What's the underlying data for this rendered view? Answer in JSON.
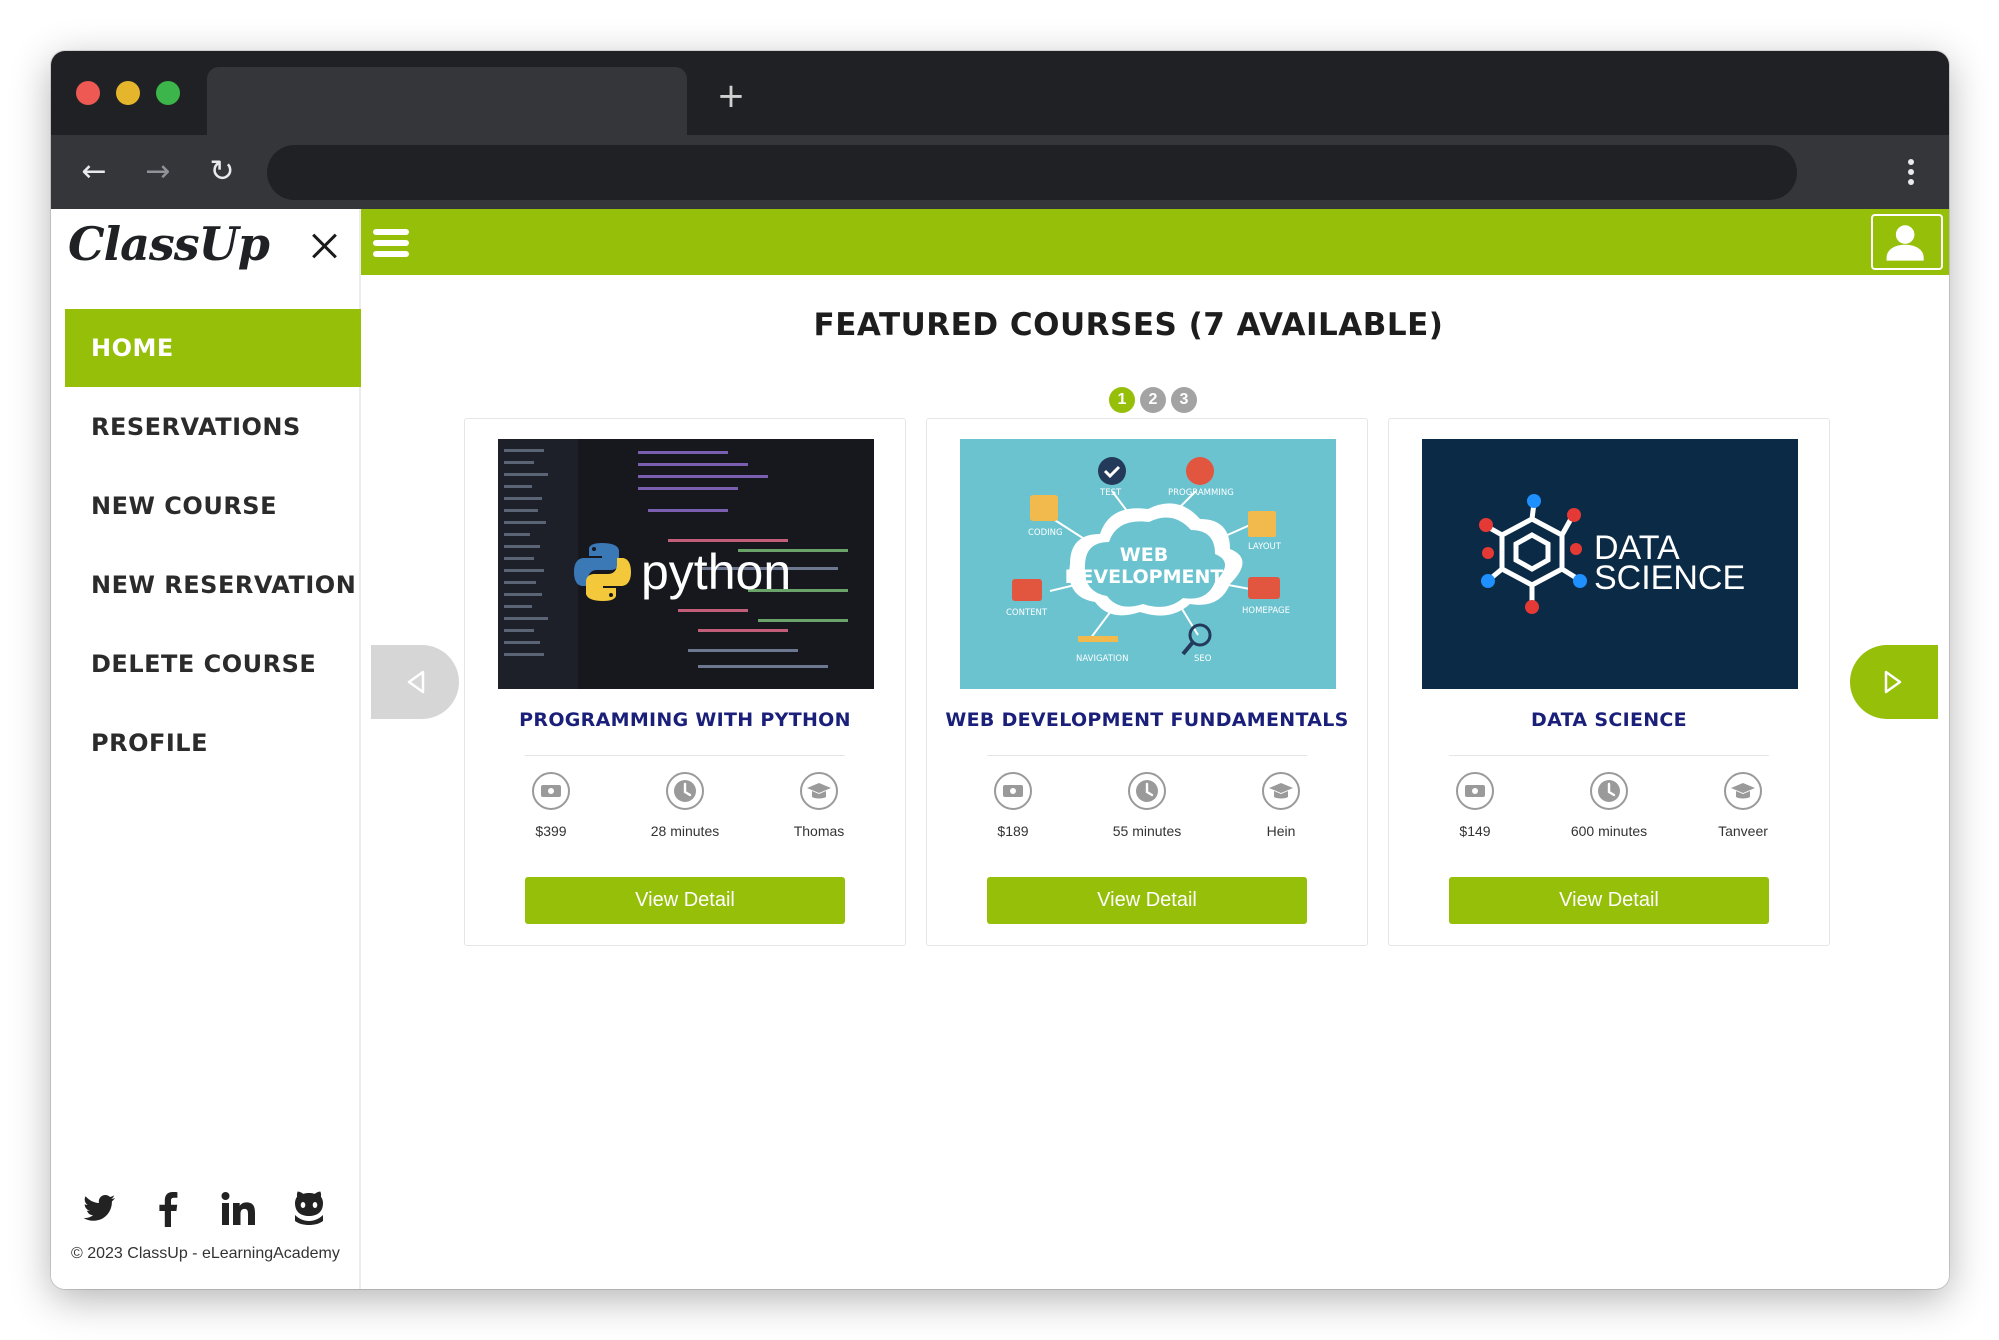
{
  "brand": {
    "logo_text": "ClassUp",
    "accent_color": "#95bf09"
  },
  "sidebar": {
    "items": [
      {
        "label": "HOME"
      },
      {
        "label": "RESERVATIONS"
      },
      {
        "label": "NEW COURSE"
      },
      {
        "label": "NEW RESERVATION"
      },
      {
        "label": "DELETE COURSE"
      },
      {
        "label": "PROFILE"
      }
    ],
    "social_icons": [
      "twitter-icon",
      "facebook-icon",
      "linkedin-icon",
      "github-icon"
    ],
    "copyright": "© 2023 ClassUp - eLearningAcademy"
  },
  "main": {
    "title": "FEATURED COURSES (7 AVAILABLE)",
    "pages": [
      "1",
      "2",
      "3"
    ],
    "current_page": "1",
    "courses": [
      {
        "title": "PROGRAMMING WITH PYTHON",
        "image_text": "python",
        "price": "$399",
        "duration": "28 minutes",
        "instructor": "Thomas",
        "button": "View Detail"
      },
      {
        "title": "WEB DEVELOPMENT FUNDAMENTALS",
        "image_text_line1": "WEB",
        "image_text_line2": "DEVELOPMENT",
        "image_labels": [
          "TEST",
          "PROGRAMMING",
          "CODING",
          "LAYOUT",
          "CONTENT",
          "HOMEPAGE",
          "NAVIGATION",
          "SEO"
        ],
        "price": "$189",
        "duration": "55 minutes",
        "instructor": "Hein",
        "button": "View Detail"
      },
      {
        "title": "DATA SCIENCE",
        "image_text_line1": "DATA",
        "image_text_line2": "SCIENCE",
        "price": "$149",
        "duration": "600 minutes",
        "instructor": "Tanveer",
        "button": "View Detail"
      }
    ]
  }
}
